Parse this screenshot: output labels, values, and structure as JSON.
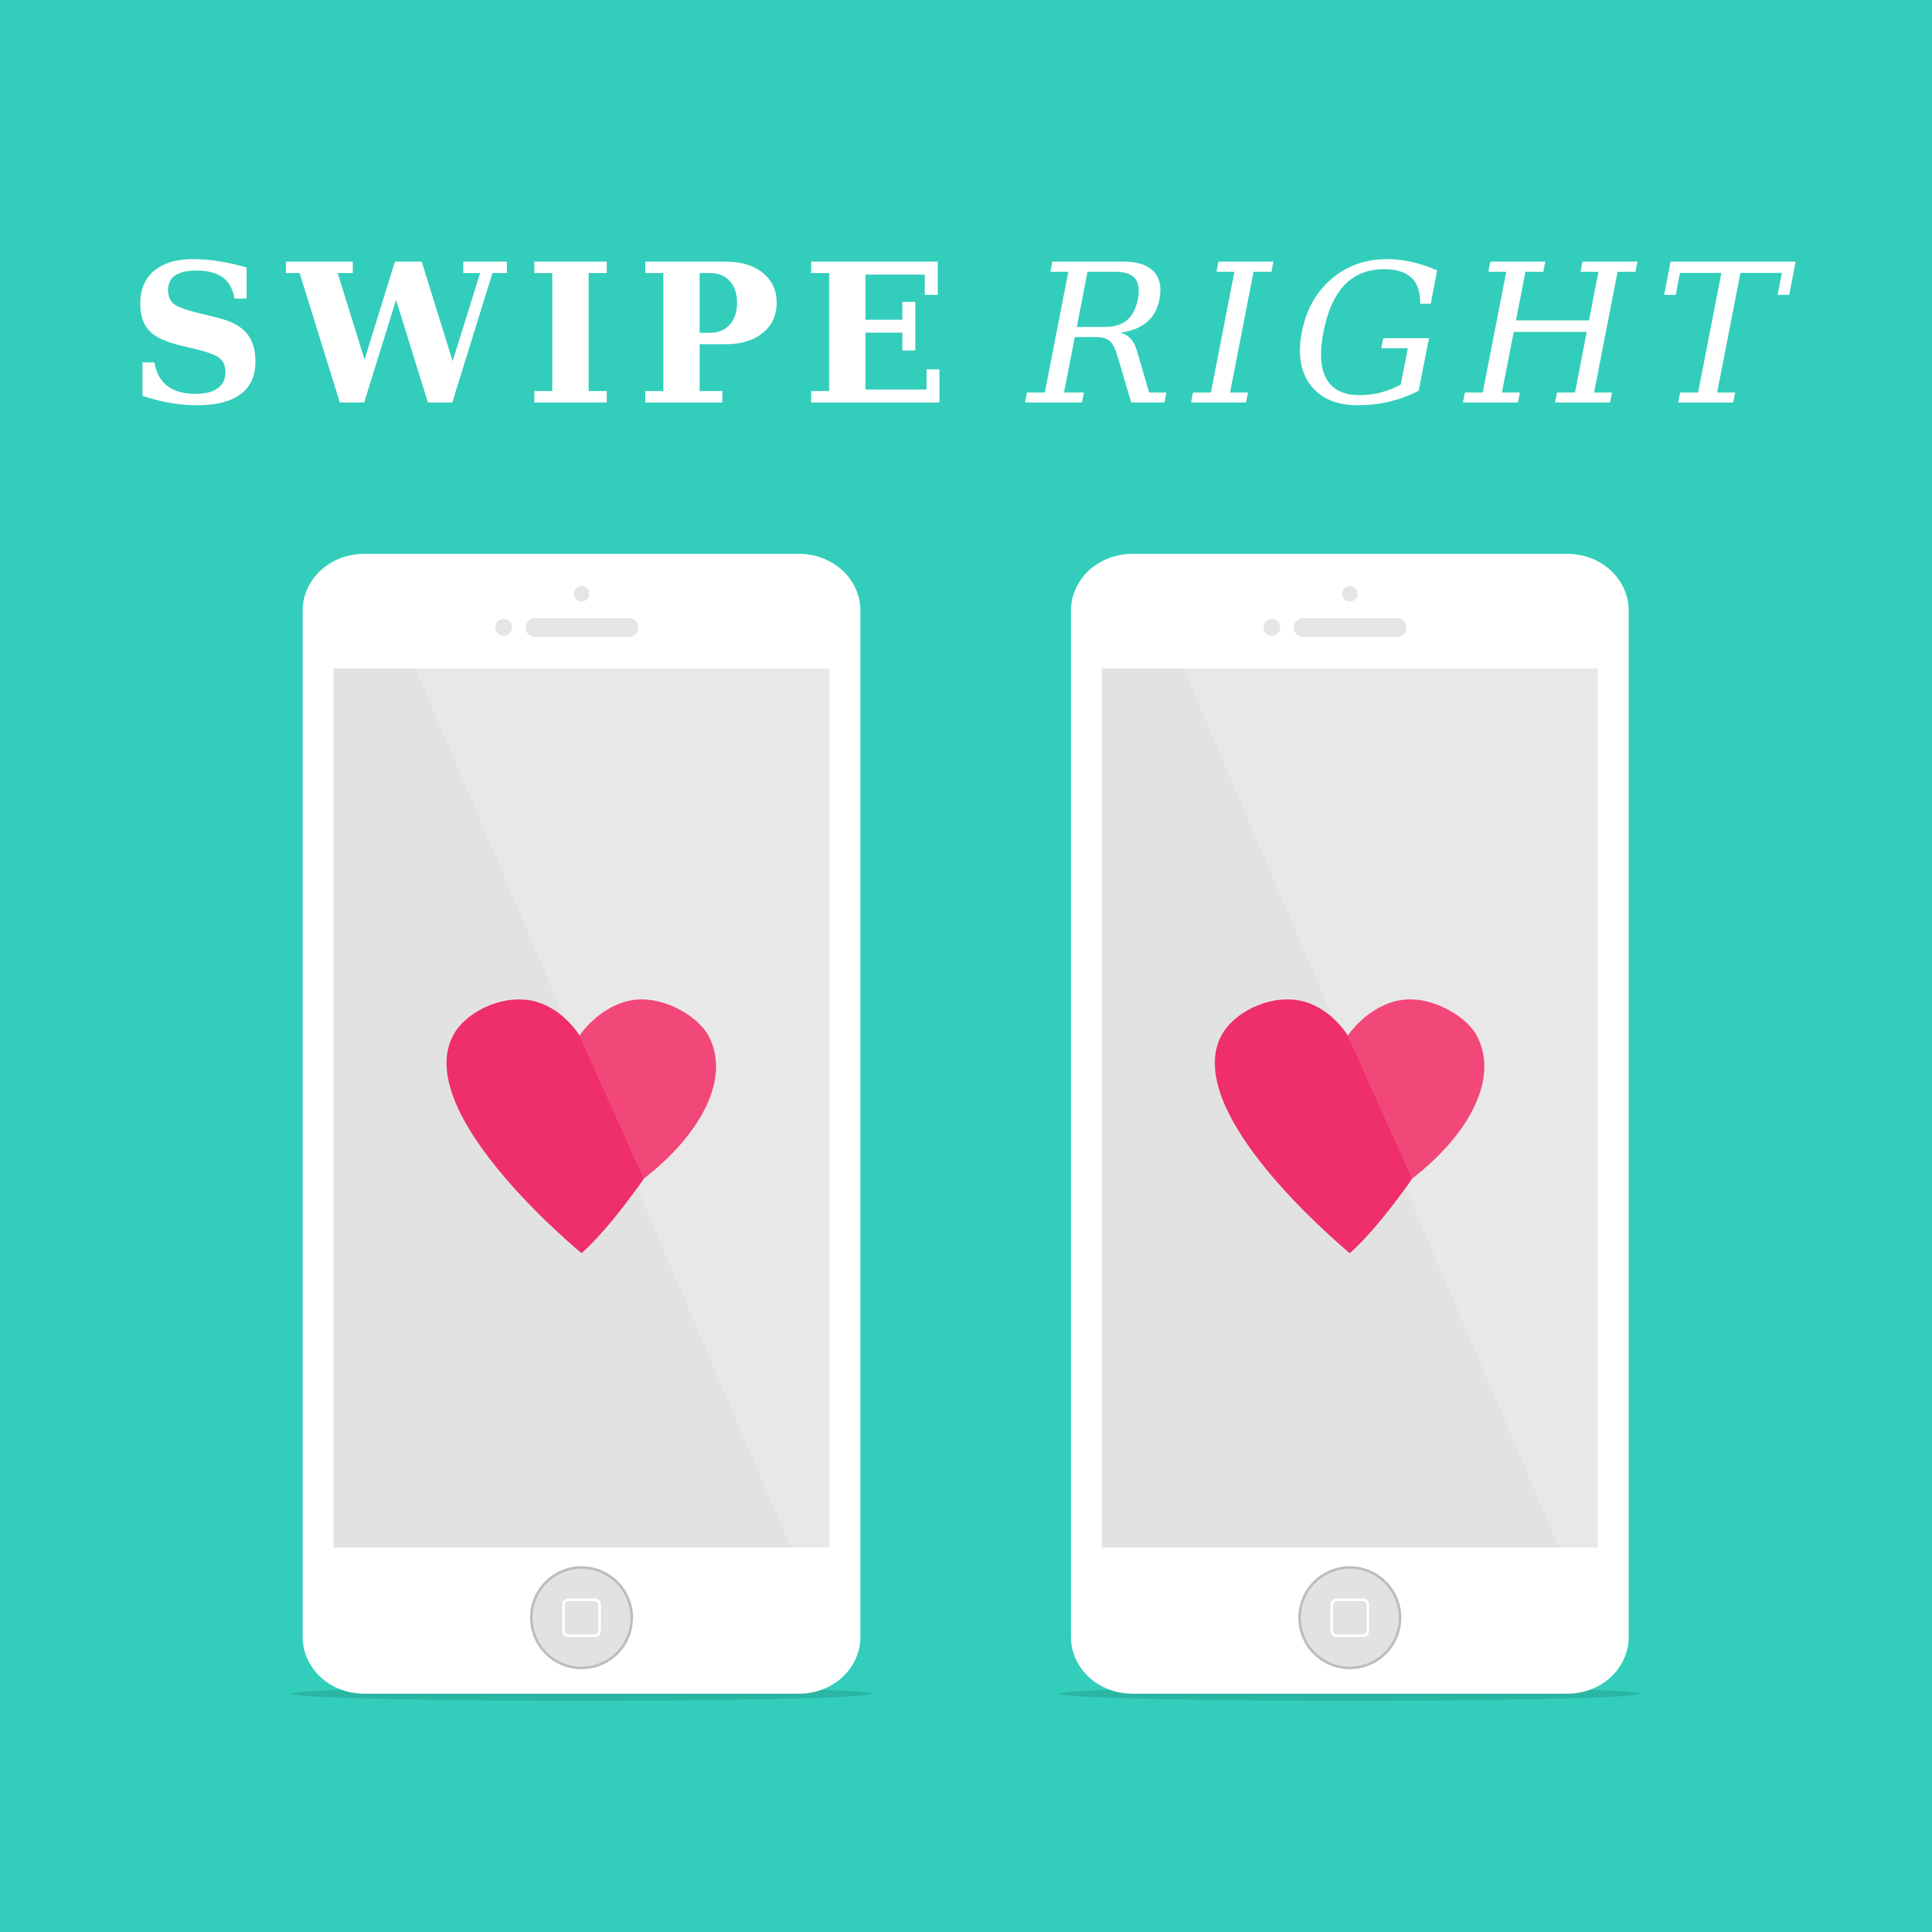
{
  "headline": {
    "word1": "SWIPE",
    "word2": "RIGHT"
  },
  "colors": {
    "background": "#33cebb",
    "shadow": "#2bb5a3",
    "phone_body": "#ffffff",
    "screen": "#e2e2e2",
    "screen_glare": "#e8e8e8",
    "speaker_camera": "#e5e5e5",
    "home_button_fill": "#e2e2e2",
    "home_button_border": "#bdbdbd",
    "heart_primary": "#ef2f69",
    "heart_secondary": "#f24879"
  },
  "phones": [
    {
      "id": "left",
      "icon": "heart-icon"
    },
    {
      "id": "right",
      "icon": "heart-icon"
    }
  ]
}
